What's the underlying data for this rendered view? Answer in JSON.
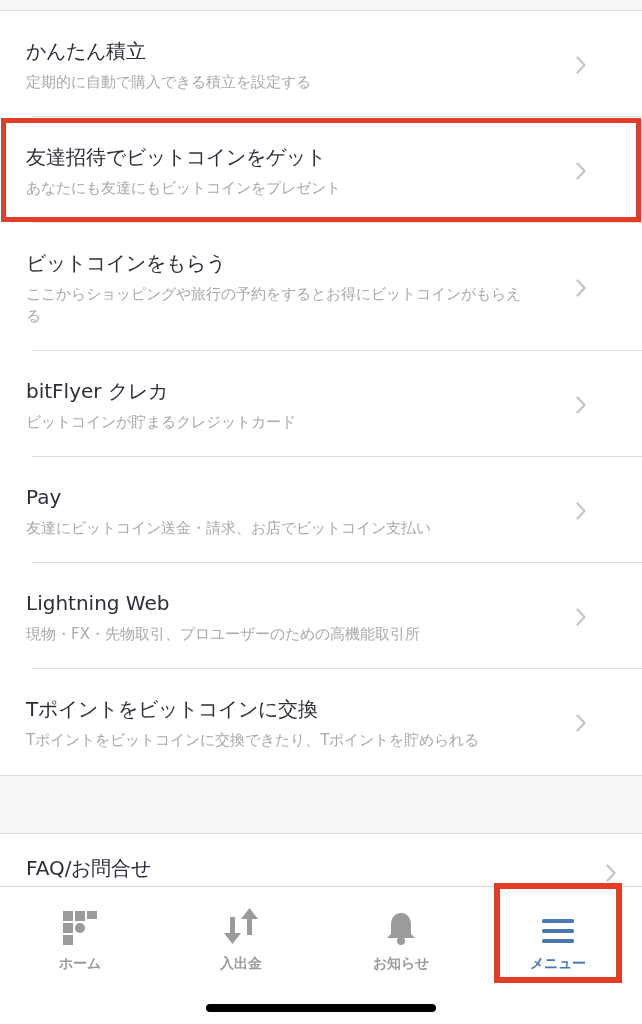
{
  "menu_items": [
    {
      "title": "かんたん積立",
      "subtitle": "定期的に自動で購入できる積立を設定する",
      "highlighted": false
    },
    {
      "title": "友達招待でビットコインをゲット",
      "subtitle": "あなたにも友達にもビットコインをプレゼント",
      "highlighted": true
    },
    {
      "title": "ビットコインをもらう",
      "subtitle": "ここからショッピングや旅行の予約をするとお得にビットコインがもらえる",
      "highlighted": false
    },
    {
      "title": "bitFlyer クレカ",
      "subtitle": "ビットコインが貯まるクレジットカード",
      "highlighted": false
    },
    {
      "title": "Pay",
      "subtitle": "友達にビットコイン送金・請求、お店でビットコイン支払い",
      "highlighted": false
    },
    {
      "title": "Lightning Web",
      "subtitle": "現物・FX・先物取引、プロユーザーのための高機能取引所",
      "highlighted": false
    },
    {
      "title": "Tポイントをビットコインに交換",
      "subtitle": "Tポイントをビットコインに交換できたり、Tポイントを貯められる",
      "highlighted": false
    }
  ],
  "second_section": [
    {
      "title": "FAQ/お問合せ"
    }
  ],
  "tab_bar": [
    {
      "kind": "home",
      "label": "ホーム",
      "selected": false,
      "highlighted": false
    },
    {
      "kind": "transfer",
      "label": "入出金",
      "selected": false,
      "highlighted": false
    },
    {
      "kind": "bell",
      "label": "お知らせ",
      "selected": false,
      "highlighted": false
    },
    {
      "kind": "menu",
      "label": "メニュー",
      "selected": true,
      "highlighted": true
    }
  ]
}
